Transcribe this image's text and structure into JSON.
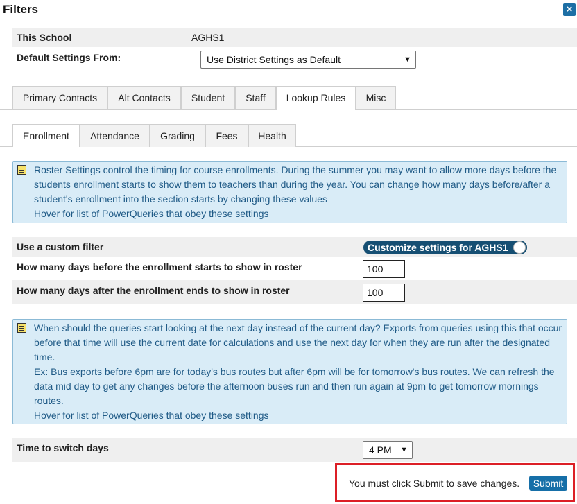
{
  "dialog": {
    "title": "Filters",
    "close_icon": "×"
  },
  "school": {
    "label": "This School",
    "value": "AGHS1",
    "default_label": "Default Settings From:",
    "default_value": "Use District Settings as Default"
  },
  "main_tabs": [
    "Primary Contacts",
    "Alt Contacts",
    "Student",
    "Staff",
    "Lookup Rules",
    "Misc"
  ],
  "main_tab_active": "Lookup Rules",
  "sub_tabs": [
    "Enrollment",
    "Attendance",
    "Grading",
    "Fees",
    "Health"
  ],
  "sub_tab_active": "Enrollment",
  "info1": {
    "lines": [
      "Roster Settings control the timing for course enrollments. During the summer you may want to allow more days before the",
      "students enrollment starts to show them to teachers than during the year. You can change how many days before/after a",
      "student's enrollment into the section starts by changing these values",
      "Hover for list of PowerQueries that obey these settings"
    ]
  },
  "settings": {
    "custom_filter_label": "Use a custom filter",
    "toggle_label": "Customize settings for AGHS1",
    "days_before_label": "How many days before the enrollment starts to show in roster",
    "days_before_value": "100",
    "days_after_label": "How many days after the enrollment ends to show in roster",
    "days_after_value": "100"
  },
  "info2": {
    "lines": [
      "When should the queries start looking at the next day instead of the current day? Exports from queries using this that occur",
      "before that time will use the current date for calculations and use the next day for when they are run after the designated",
      "time.",
      "Ex: Bus exports before 6pm are for today's bus routes but after 6pm will be for tomorrow's bus routes. We can refresh the",
      "data mid day to get any changes before the afternoon buses run and then run again at 9pm to get tomorrow mornings",
      "routes.",
      "Hover for list of PowerQueries that obey these settings"
    ]
  },
  "switch": {
    "label": "Time to switch days",
    "value": "4 PM"
  },
  "footer": {
    "message": "You must click Submit to save changes.",
    "submit_label": "Submit"
  },
  "colors": {
    "accent": "#166fa8",
    "toggle": "#164f73",
    "info_bg": "#d9ecf7",
    "info_text": "#1f5a86",
    "highlight": "#dc1f26"
  }
}
